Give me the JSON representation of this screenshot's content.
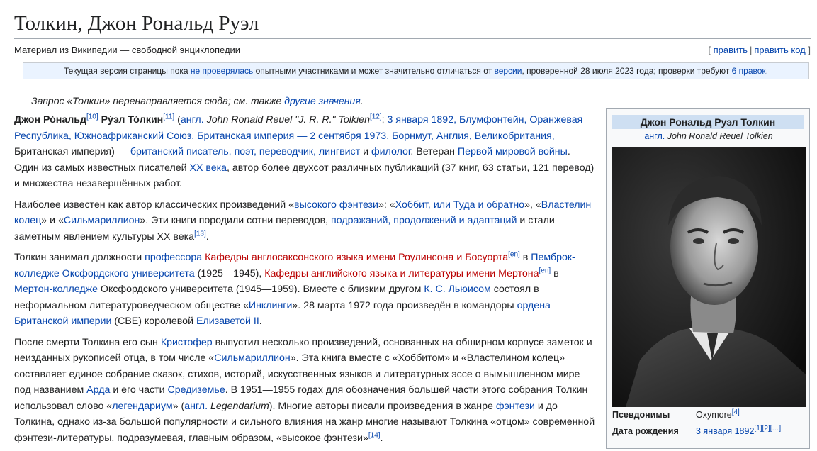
{
  "page": {
    "title": "Толкин, Джон Рональд Руэл",
    "site_sub": "Материал из Википедии — свободной энциклопедии",
    "edit_links": {
      "open": "[",
      "edit": "править",
      "sep": "|",
      "edit_code": "править код",
      "close": "]"
    }
  },
  "flagged": {
    "t1": "Текущая версия страницы пока ",
    "l1": "не проверялась",
    "t2": " опытными участниками и может значительно отличаться от ",
    "l2": "версии",
    "t3": ", проверенной 28 июля 2023 года; проверки требуют ",
    "l3": "6 правок",
    "t4": "."
  },
  "hatnote": {
    "text": "Запрос «Толкин» перенаправляется сюда; см. также ",
    "link": "другие значения",
    "end": "."
  },
  "p1": {
    "b1": "Джон Ро́нальд",
    "r10": "[10]",
    "b2": " Ру́эл То́лкин",
    "r11": "[11]",
    "t1": " (",
    "lang": "англ.",
    "name_en": " John Ronald Reuel \"J. R. R.\" Tolkien",
    "r12": "[12]",
    "t2": "; ",
    "l_birth": "3 января 1892, Блумфонтейн, Оранжевая Республика, Южноафриканский Союз, Британская империя",
    "t3": " — ",
    "l_death": "2 сентября 1973, Борнмут, Англия, Великобритания,",
    "t4": " Британская империя) — ",
    "l_prof": "британский писатель, поэт, переводчик, лингвист",
    "t5": " и ",
    "l_phil": "филолог",
    "t6": ". Ветеран ",
    "l_ww1": "Первой мировой войны",
    "t7": ". Один из самых известных писателей ",
    "l_c20": "XX века",
    "t8": ", автор более двухсот различных публикаций (37 книг, 63 статьи, 121 перевод) и множества незавершённых работ."
  },
  "p2": {
    "t1": "Наиболее известен как автор классических произведений «",
    "l1": "высокого фэнтези",
    "t2": "»: «",
    "l2": "Хоббит, или Туда и обратно",
    "t3": "», «",
    "l3": "Властелин колец",
    "t4": "» и «",
    "l4": "Сильмариллион",
    "t5": "». Эти книги породили сотни переводов, ",
    "l5": "подражаний, продолжений и адаптаций",
    "t6": " и стали заметным явлением культуры XX века",
    "r13": "[13]",
    "t7": "."
  },
  "p3": {
    "t1": "Толкин занимал должности ",
    "l1": "профессора",
    "t2": " ",
    "red1": "Кафедры англосаксонского языка имени Роулинсона и Босуорта",
    "en1": "[en]",
    "t3": " в ",
    "l2": "Пемброк-колледже Оксфордского университета",
    "t4": " (1925—1945), ",
    "red2": "Кафедры английского языка и литературы имени Мертона",
    "en2": "[en]",
    "t5": " в ",
    "l3": "Мертон-колледже",
    "t6": " Оксфордского университета (1945—1959). Вместе с близким другом ",
    "l4": "К. С. Льюисом",
    "t7": " состоял в неформальном литературоведческом обществе «",
    "l5": "Инклинги",
    "t8": "». 28 марта 1972 года произведён в командоры ",
    "l6": "ордена Британской империи",
    "t9": " (CBE) королевой ",
    "l7": "Елизаветой II",
    "t10": "."
  },
  "p4": {
    "t1": "После смерти Толкина его сын ",
    "l1": "Кристофер",
    "t2": " выпустил несколько произведений, основанных на обширном корпусе заметок и неизданных рукописей отца, в том числе «",
    "l2": "Сильмариллион",
    "t3": "». Эта книга вместе с «Хоббитом» и «Властелином колец» составляет единое собрание сказок, стихов, историй, искусственных языков и литературных эссе о вымышленном мире под названием ",
    "l3": "Арда",
    "t4": " и его части ",
    "l4": "Средиземье",
    "t5": ". В 1951—1955 годах для обозначения большей части этого собрания Толкин использовал слово «",
    "l5": "легендариум",
    "t6": "» (",
    "l6": "англ.",
    "t7": " ",
    "it1": "Legendarium",
    "t8": "). Многие авторы писали произведения в жанре ",
    "l7": "фэнтези",
    "t9": " и до Толкина, однако из-за большой популярности и сильного влияния на жанр многие называют Толкина «отцом» современной фэнтези-литературы, подразумевая, главным образом, «высокое фэнтези»",
    "r14": "[14]",
    "t10": "."
  },
  "infobox": {
    "title": "Джон Рональд Руэл Толкин",
    "orig_lang": "англ.",
    "orig_name": "John Ronald Reuel Tolkien",
    "rows": [
      {
        "label": "Псевдонимы",
        "value": "Oxymore",
        "ref": "[4]"
      },
      {
        "label": "Дата рождения",
        "value": "3 января 1892",
        "ref": "[1][2][…]"
      }
    ]
  }
}
